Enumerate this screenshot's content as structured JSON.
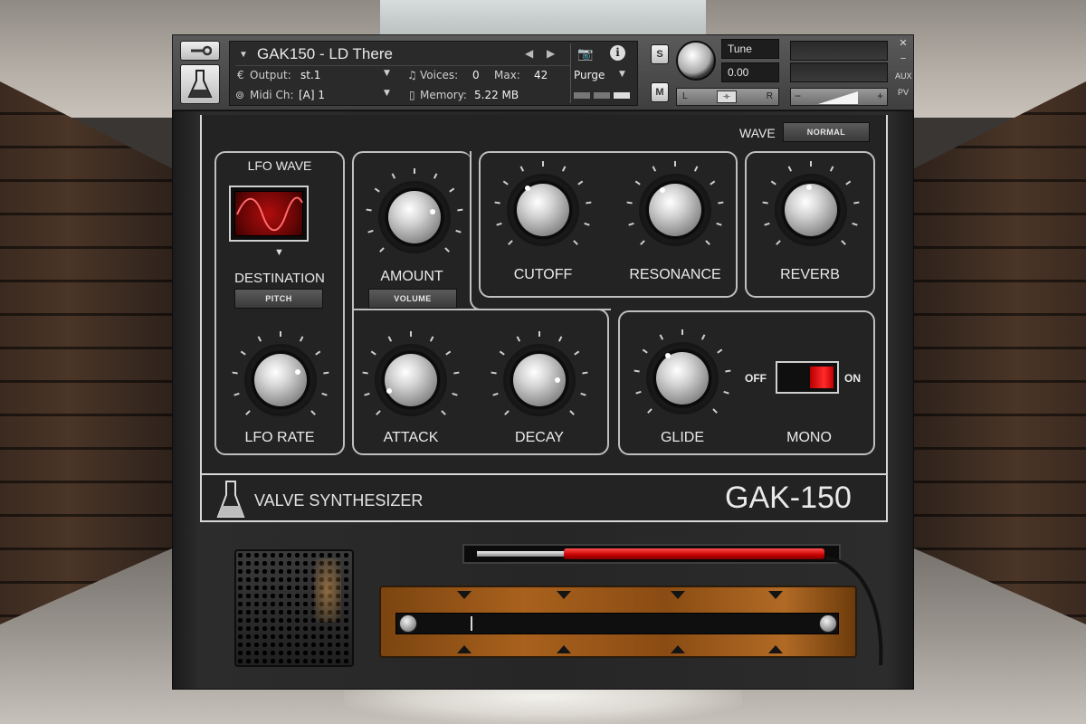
{
  "header": {
    "instrument_name": "GAK150 - LD There",
    "output_label": "Output:",
    "output_value": "st.1",
    "voices_label": "Voices:",
    "voices_value": "0",
    "max_label": "Max:",
    "max_value": "42",
    "purge_label": "Purge",
    "midi_label": "Midi Ch:",
    "midi_value": "[A] 1",
    "memory_label": "Memory:",
    "memory_value": "5.22 MB",
    "solo_label": "S",
    "mute_label": "M",
    "tune_label": "Tune",
    "tune_value": "0.00",
    "pan_left": "L",
    "pan_right": "R",
    "aux_label": "AUX",
    "pv_label": "PV"
  },
  "panel": {
    "wave_label": "WAVE",
    "wave_value": "NORMAL",
    "lfo_wave_label": "LFO WAVE",
    "destination_label": "DESTINATION",
    "destination_value": "PITCH",
    "lfo_rate_label": "LFO RATE",
    "amount_label": "AMOUNT",
    "amount_target": "VOLUME",
    "cutoff_label": "CUTOFF",
    "resonance_label": "RESONANCE",
    "reverb_label": "REVERB",
    "attack_label": "ATTACK",
    "decay_label": "DECAY",
    "glide_label": "GLIDE",
    "mono_label": "MONO",
    "off_label": "OFF",
    "on_label": "ON",
    "brand_label": "VALVE SYNTHESIZER",
    "model_label": "GAK-150"
  },
  "colors": {
    "accent_red": "#d40000",
    "panel_bg": "#232323",
    "ribbon_copper": "#a9611d"
  }
}
